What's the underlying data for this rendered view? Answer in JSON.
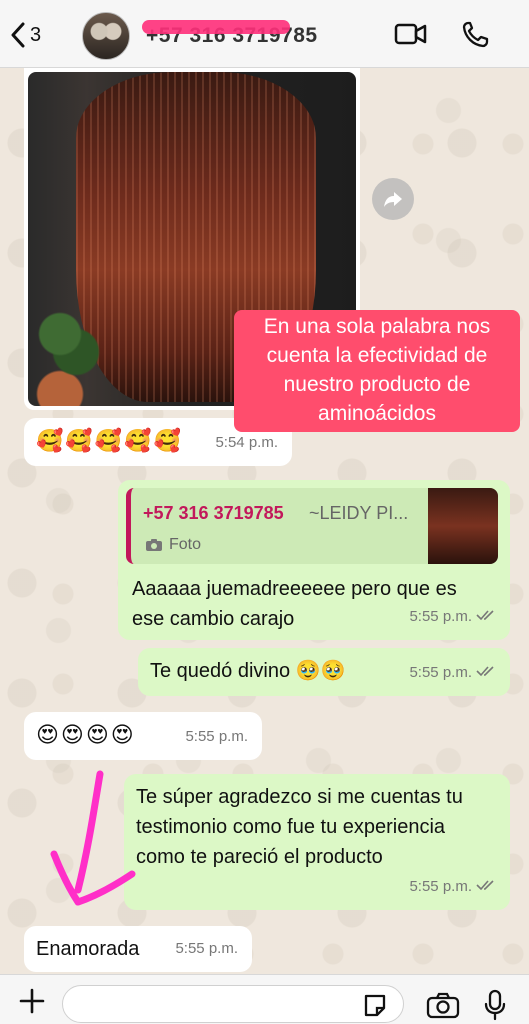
{
  "header": {
    "back_count": "3",
    "contact_name": "+57 316 3719785",
    "video_icon": "video-call-icon",
    "call_icon": "phone-icon"
  },
  "messages": {
    "photo_caption": "En una sola palabra nos cuenta la efectividad de nuestro producto de aminoácidos",
    "m1_text": "🥰🥰🥰🥰🥰",
    "m1_time": "5:54 p.m.",
    "quote_from": "+57 316 3719785",
    "quote_name": "~LEIDY PI...",
    "quote_type": "Foto",
    "m2_text": "Aaaaaa juemadreeeeee pero que es ese cambio carajo",
    "m2_time": "5:55 p.m.",
    "m3_text": "Te quedó divino 🥹🥹",
    "m3_time": "5:55 p.m.",
    "m4_text": "😍😍😍😍",
    "m4_time": "5:55 p.m.",
    "m5_text": "Te súper agradezco si me cuentas tu testimonio como fue tu experiencia como te pareció el producto",
    "m5_time": "5:55 p.m.",
    "m6_text": "Enamorada",
    "m6_time": "5:55 p.m."
  },
  "input_bar": {
    "placeholder": ""
  },
  "colors": {
    "outgoing_bubble": "#dcf8c6",
    "incoming_bubble": "#ffffff",
    "caption_bg": "#ff4d6d",
    "arrow": "#ff2fc8",
    "quote_accent": "#c2185b"
  }
}
